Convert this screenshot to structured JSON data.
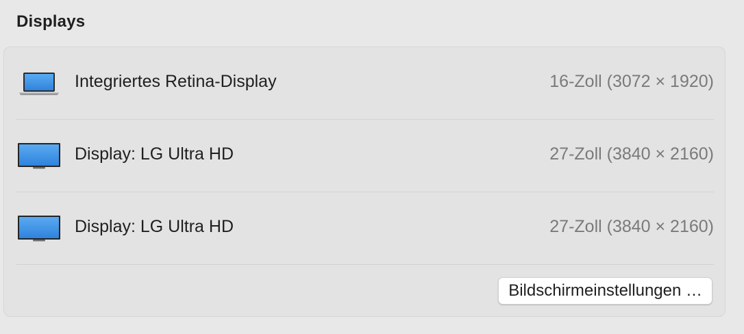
{
  "section": {
    "title": "Displays"
  },
  "displays": [
    {
      "icon": "laptop-icon",
      "name": "Integriertes Retina-Display",
      "spec": "16-Zoll (3072 × 1920)"
    },
    {
      "icon": "monitor-icon",
      "name": "Display: LG Ultra HD",
      "spec": "27-Zoll (3840 × 2160)"
    },
    {
      "icon": "monitor-icon",
      "name": "Display: LG Ultra HD",
      "spec": "27-Zoll (3840 × 2160)"
    }
  ],
  "actions": {
    "settings_label": "Bildschirmeinstellungen …"
  },
  "colors": {
    "background": "#e8e8e8",
    "panel": "#e3e3e3",
    "screen_blue": "#3d92e6",
    "secondary_text": "#7a7a7a"
  }
}
